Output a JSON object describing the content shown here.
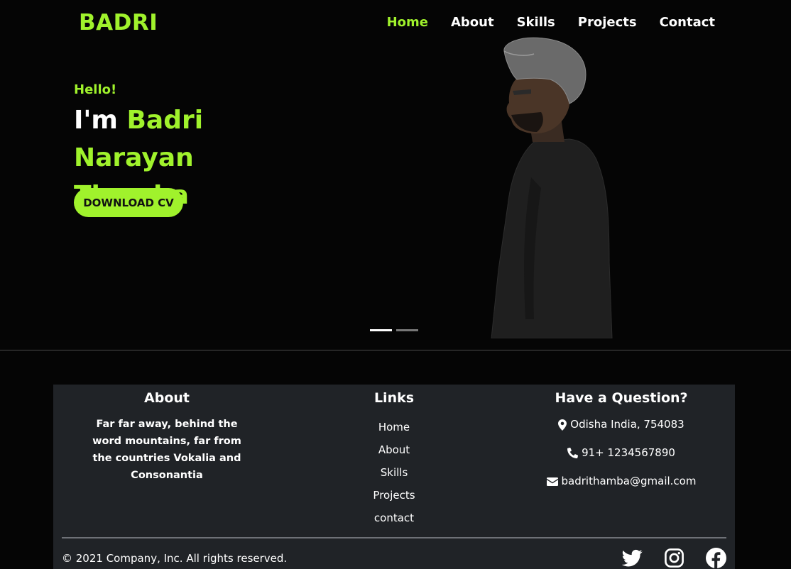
{
  "brand": "BADRI",
  "nav": {
    "home": "Home",
    "about": "About",
    "skills": "Skills",
    "projects": "Projects",
    "contact": "Contact"
  },
  "hero": {
    "greeting": "Hello!",
    "im": "I'm ",
    "name": "Badri Narayan Thamba",
    "cta": "DOWNLOAD CV",
    "slides_total": 2,
    "active_slide": 1
  },
  "footer": {
    "about": {
      "title": "About",
      "text": "Far far away, behind the word mountains, far from the countries Vokalia and Consonantia"
    },
    "links": {
      "title": "Links",
      "items": [
        "Home",
        "About",
        "Skills",
        "Projects",
        "contact"
      ]
    },
    "contact": {
      "title": "Have a Question?",
      "address": "Odisha India, 754083",
      "phone": "91+ 1234567890",
      "email": "badrithamba@gmail.com"
    },
    "copyright": "© 2021 Company, Inc. All rights reserved.",
    "socials": [
      "twitter-icon",
      "instagram-icon",
      "facebook-icon"
    ]
  },
  "colors": {
    "accent": "#a0f22c",
    "background": "#050505",
    "footer_bg": "#202327"
  }
}
